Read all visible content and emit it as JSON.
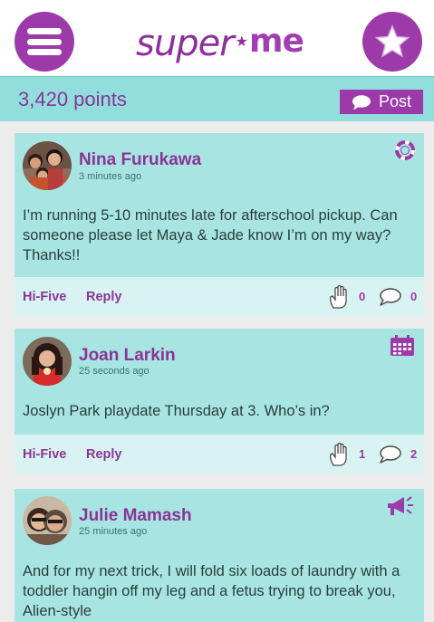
{
  "header": {
    "menu_icon": "hamburger-menu-icon",
    "logo": {
      "super": "super",
      "me": "me",
      "star": "★"
    },
    "favorites_icon": "star-icon"
  },
  "points_bar": {
    "points_text": "3,420 points",
    "post_label": "Post",
    "post_icon": "speech-bubble-icon"
  },
  "colors": {
    "brand_purple": "#9b3aa8",
    "teal_bar": "#92dedd",
    "card_bg": "#a8e5e2",
    "action_bg": "#d8f3f2"
  },
  "posts": [
    {
      "author": "Nina Furukawa",
      "time": "3 minutes ago",
      "category_icon": "lifebuoy-icon",
      "text": "I’m running 5-10 minutes late for afterschool pickup. Can someone please let Maya & Jade know I’m on my way? Thanks!!",
      "hifive_label": "Hi-Five",
      "reply_label": "Reply",
      "hifive_count": "0",
      "reply_count": "0"
    },
    {
      "author": "Joan Larkin",
      "time": "25 seconds ago",
      "category_icon": "calendar-icon",
      "text": "Joslyn Park playdate Thursday at 3. Who’s in?",
      "hifive_label": "Hi-Five",
      "reply_label": "Reply",
      "hifive_count": "1",
      "reply_count": "2"
    },
    {
      "author": "Julie Mamash",
      "time": "25 minutes ago",
      "category_icon": "megaphone-icon",
      "text": "And for my next trick, I will fold six loads of laundry with a toddler hangin off my leg and a fetus trying to break you, Alien-style"
    }
  ]
}
